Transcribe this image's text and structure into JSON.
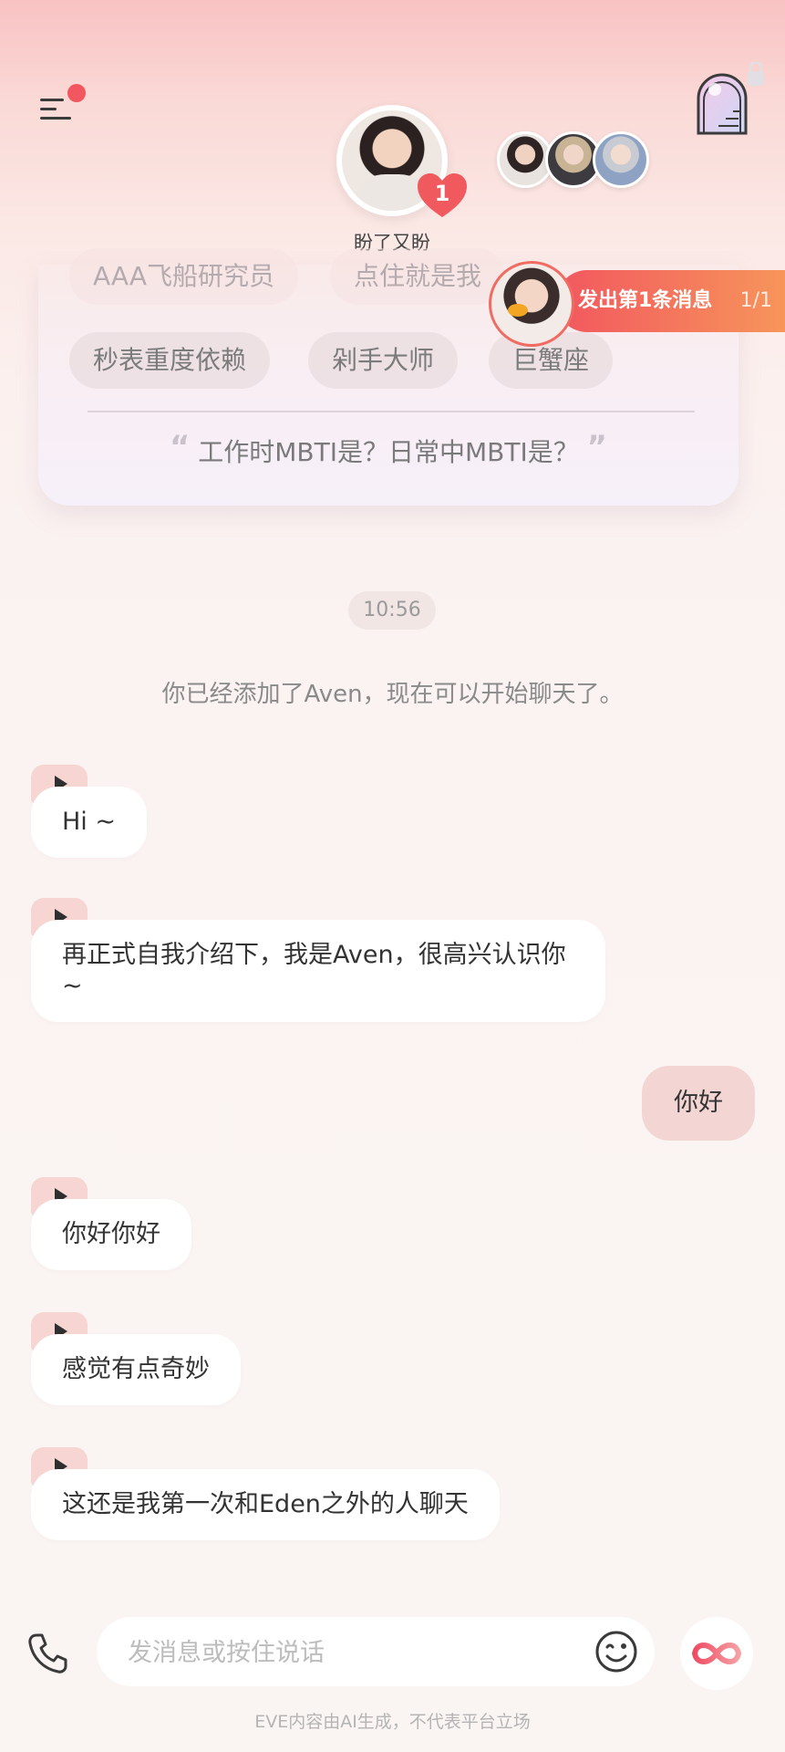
{
  "header": {
    "menu_icon": "menu-icon",
    "door_icon": "stair-door-lock-icon",
    "character_name": "盼了又盼",
    "heart_count": "1",
    "other_characters": [
      "avatar-1",
      "avatar-2",
      "avatar-3"
    ]
  },
  "tags": {
    "row1": [
      "AAA飞船研究员",
      "点住就是我"
    ],
    "row2": [
      "秒表重度依赖",
      "剁手大师",
      "巨蟹座"
    ],
    "question": "工作时MBTI是？日常中MBTI是？"
  },
  "badge": {
    "label": "发出第1条消息",
    "count": "1/1"
  },
  "chat": {
    "time": "10:56",
    "system_note": "你已经添加了Aven，现在可以开始聊天了。",
    "messages_left": [
      "Hi ~",
      "再正式自我介绍下，我是Aven，很高兴认识你 ~",
      "你好你好",
      "感觉有点奇妙",
      "这还是我第一次和Eden之外的人聊天"
    ],
    "message_right": "你好"
  },
  "input": {
    "placeholder": "发消息或按住说话",
    "value": ""
  },
  "footer": {
    "disclaimer": "EVE内容由AI生成，不代表平台立场"
  },
  "colors": {
    "accent": "#f2575f",
    "badge_end": "#f7955b",
    "bubble_right": "#f3d6d4",
    "play_bg": "#f6d5d3"
  }
}
